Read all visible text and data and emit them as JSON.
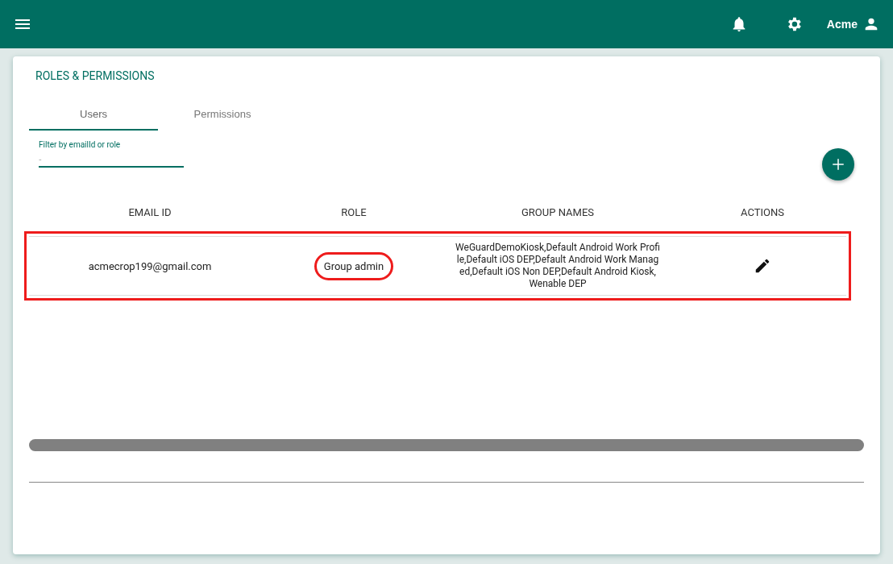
{
  "header": {
    "user_name": "Acme"
  },
  "page": {
    "title": "ROLES & PERMISSIONS"
  },
  "tabs": [
    {
      "label": "Users",
      "selected": true
    },
    {
      "label": "Permissions",
      "selected": false
    }
  ],
  "filter": {
    "label": "Filter by emailId or role",
    "placeholder": "-"
  },
  "table": {
    "columns": [
      "EMAIL ID",
      "ROLE",
      "GROUP NAMES",
      "ACTIONS"
    ],
    "rows": [
      {
        "email": "acmecrop199@gmail.com",
        "role": "Group admin",
        "groups": "WeGuardDemoKiosk,Default Android Work Profile,Default iOS DEP,Default Android Work Managed,Default iOS Non DEP,Default Android Kiosk,Wenable DEP",
        "highlighted": true
      }
    ]
  }
}
